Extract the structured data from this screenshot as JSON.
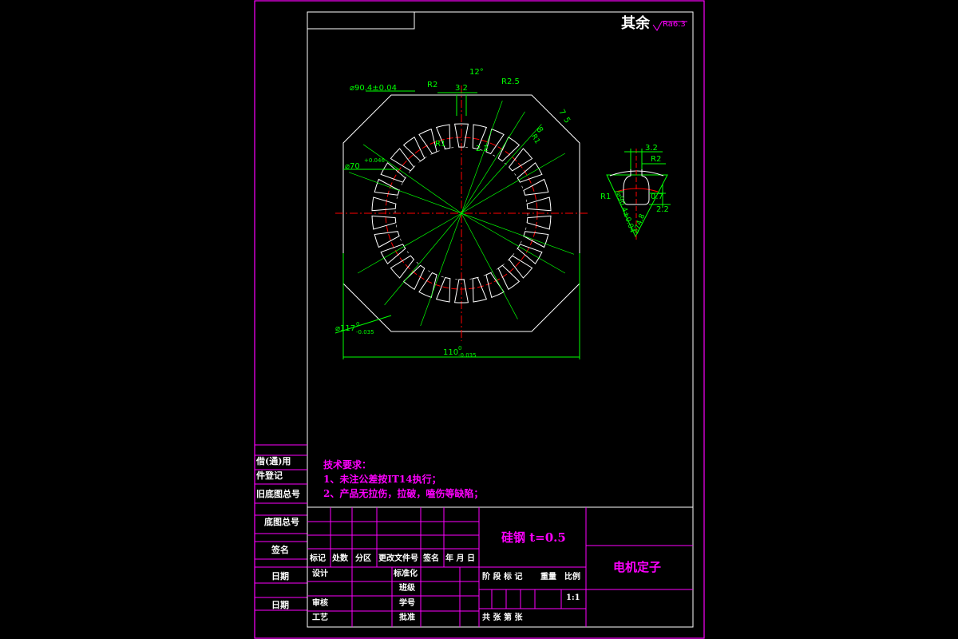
{
  "roughness": {
    "prefix": "其余",
    "symbol": "Ra6.3"
  },
  "tech_req": {
    "title": "技术要求：",
    "items": [
      "1、未注公差按IT14执行；",
      "2、产品无拉伤，拉破，嗑伤等缺陷；"
    ]
  },
  "side_labels": [
    "借(通)用",
    "件登记",
    "旧底图总号",
    "底图总号",
    "签名",
    "日期",
    "日期"
  ],
  "title_block": {
    "material": "硅钢 t=0.5",
    "part_name": "电机定子",
    "scale": "1:1",
    "rev_headers": [
      "标记",
      "处数",
      "分区",
      "更改文件号",
      "签名",
      "年 月 日"
    ],
    "roles_left": [
      "设计",
      "审核",
      "工艺"
    ],
    "roles_mid": [
      "标准化",
      "班级",
      "学号",
      "批准"
    ],
    "stage_headers": [
      "阶 段 标 记",
      "重量",
      "比例"
    ],
    "sheet": "共    张    第    张"
  },
  "dims": {
    "outer_dia": "⌀90.4±0.04",
    "bore_dia": "⌀70",
    "bore_tol": "+0.046",
    "body_dia": "⌀117",
    "body_tol_up": "0",
    "body_tol_lo": "-0.035",
    "width": "110",
    "width_tol_up": "0",
    "width_tol_lo": "-0.035",
    "r2": "R2",
    "slot_open": "3.2",
    "angle": "12°",
    "r25": "R2.5",
    "r1": "R1",
    "slot_22": "2.2",
    "d7": "7",
    "d8": "8",
    "d5": "5",
    "d_r1": "R1",
    "det_32": "3.2",
    "det_r2": "R2",
    "det_r1": "R1",
    "det_07": "0.7",
    "det_22": "2.2",
    "det_dia": "⌀90.4±0.04",
    "det_dia2": "⌀74.8"
  },
  "colors": {
    "frame": "#ff00ff",
    "outline": "#ffffff",
    "dim": "#00ff00",
    "center": "#ff0000"
  }
}
